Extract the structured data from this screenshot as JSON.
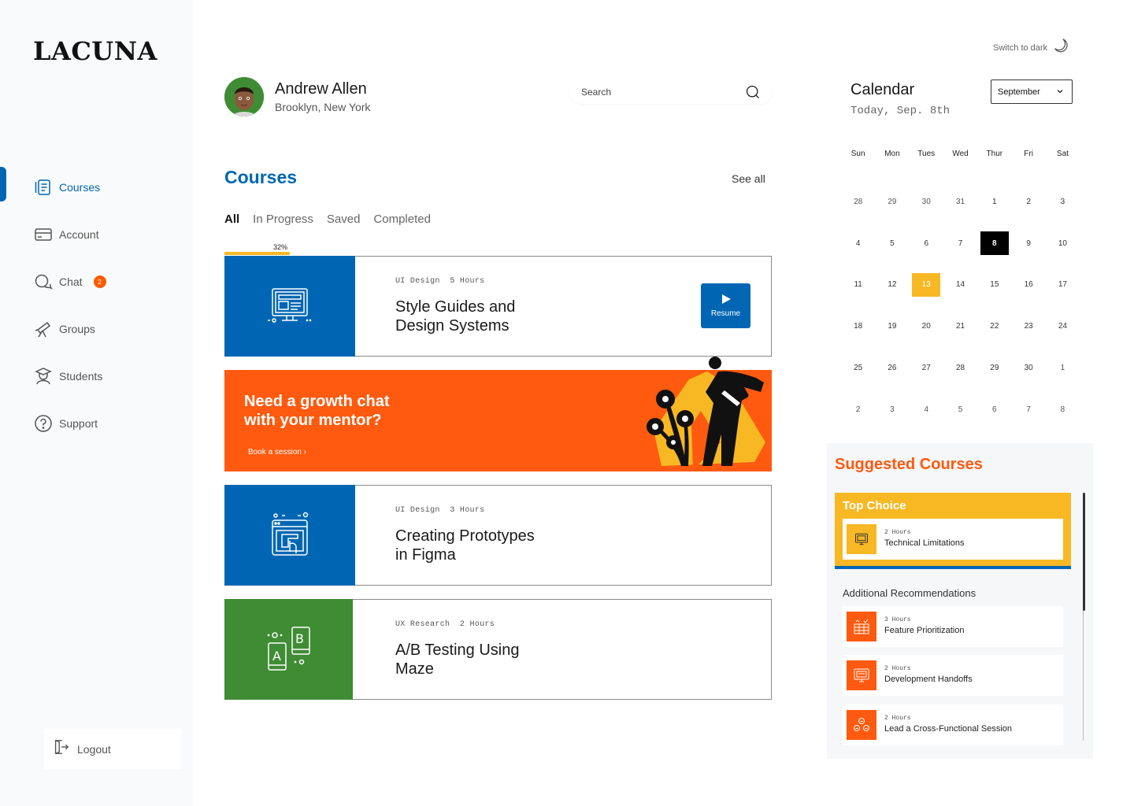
{
  "brand": {
    "logo_text": "LACUNA"
  },
  "sidebar": {
    "items": [
      {
        "label": "Courses",
        "icon": "courses-icon",
        "active": true
      },
      {
        "label": "Account",
        "icon": "account-card-icon"
      },
      {
        "label": "Chat",
        "icon": "chat-icon",
        "badge": "2"
      },
      {
        "label": "Groups",
        "icon": "telescope-icon"
      },
      {
        "label": "Students",
        "icon": "student-icon"
      },
      {
        "label": "Support",
        "icon": "question-icon"
      }
    ],
    "logout_label": "Logout"
  },
  "user": {
    "name": "Andrew Allen",
    "location": "Brooklyn, New York"
  },
  "search": {
    "placeholder": "Search"
  },
  "courses": {
    "title": "Courses",
    "see_all": "See all",
    "filters": [
      "All",
      "In Progress",
      "Saved",
      "Completed"
    ],
    "active_filter": "All",
    "progress_label": "32%",
    "progress_value": 0.32,
    "items": [
      {
        "category": "UI Design",
        "hours": "5 Hours",
        "title_line1": "Style Guides and",
        "title_line2": "Design Systems",
        "resume_label": "Resume",
        "thumb_color": "#0066b3"
      },
      {
        "category": "UI Design",
        "hours": "3 Hours",
        "title_line1": "Creating Prototypes",
        "title_line2": "in Figma",
        "thumb_color": "#0066b3"
      },
      {
        "category": "UX Research",
        "hours": "2 Hours",
        "title_line1": "A/B Testing Using",
        "title_line2": "Maze",
        "thumb_color": "#3f8c34"
      }
    ]
  },
  "banner": {
    "title_line1": "Need a growth chat",
    "title_line2": "with your mentor?",
    "link": "Book a session ›",
    "color": "#ff5a0f"
  },
  "calendar": {
    "dark_toggle": "Switch to dark",
    "title": "Calendar",
    "today": "Today, Sep. 8th",
    "month": "September",
    "weekdays": [
      "Sun",
      "Mon",
      "Tues",
      "Wed",
      "Thur",
      "Fri",
      "Sat"
    ],
    "weeks": [
      [
        "28",
        "29",
        "30",
        "31",
        "1",
        "2",
        "3"
      ],
      [
        "4",
        "5",
        "6",
        "7",
        "8",
        "9",
        "10"
      ],
      [
        "11",
        "12",
        "13",
        "14",
        "15",
        "16",
        "17"
      ],
      [
        "18",
        "19",
        "20",
        "21",
        "22",
        "23",
        "24"
      ],
      [
        "25",
        "26",
        "27",
        "28",
        "29",
        "30",
        "1"
      ],
      [
        "2",
        "3",
        "4",
        "5",
        "6",
        "7",
        "8"
      ]
    ],
    "today_day": "8",
    "event_day": "13",
    "accent_color": "#f7b824"
  },
  "suggested": {
    "title": "Suggested Courses",
    "top_choice_label": "Top Choice",
    "top_choice": {
      "hours": "2 Hours",
      "name": "Technical Limitations"
    },
    "additional_label": "Additional Recommendations",
    "items": [
      {
        "hours": "3 Hours",
        "name": "Feature Prioritization"
      },
      {
        "hours": "2 Hours",
        "name": "Development Handoffs"
      },
      {
        "hours": "2 Hours",
        "name": "Lead a Cross-Functional Session"
      }
    ]
  }
}
